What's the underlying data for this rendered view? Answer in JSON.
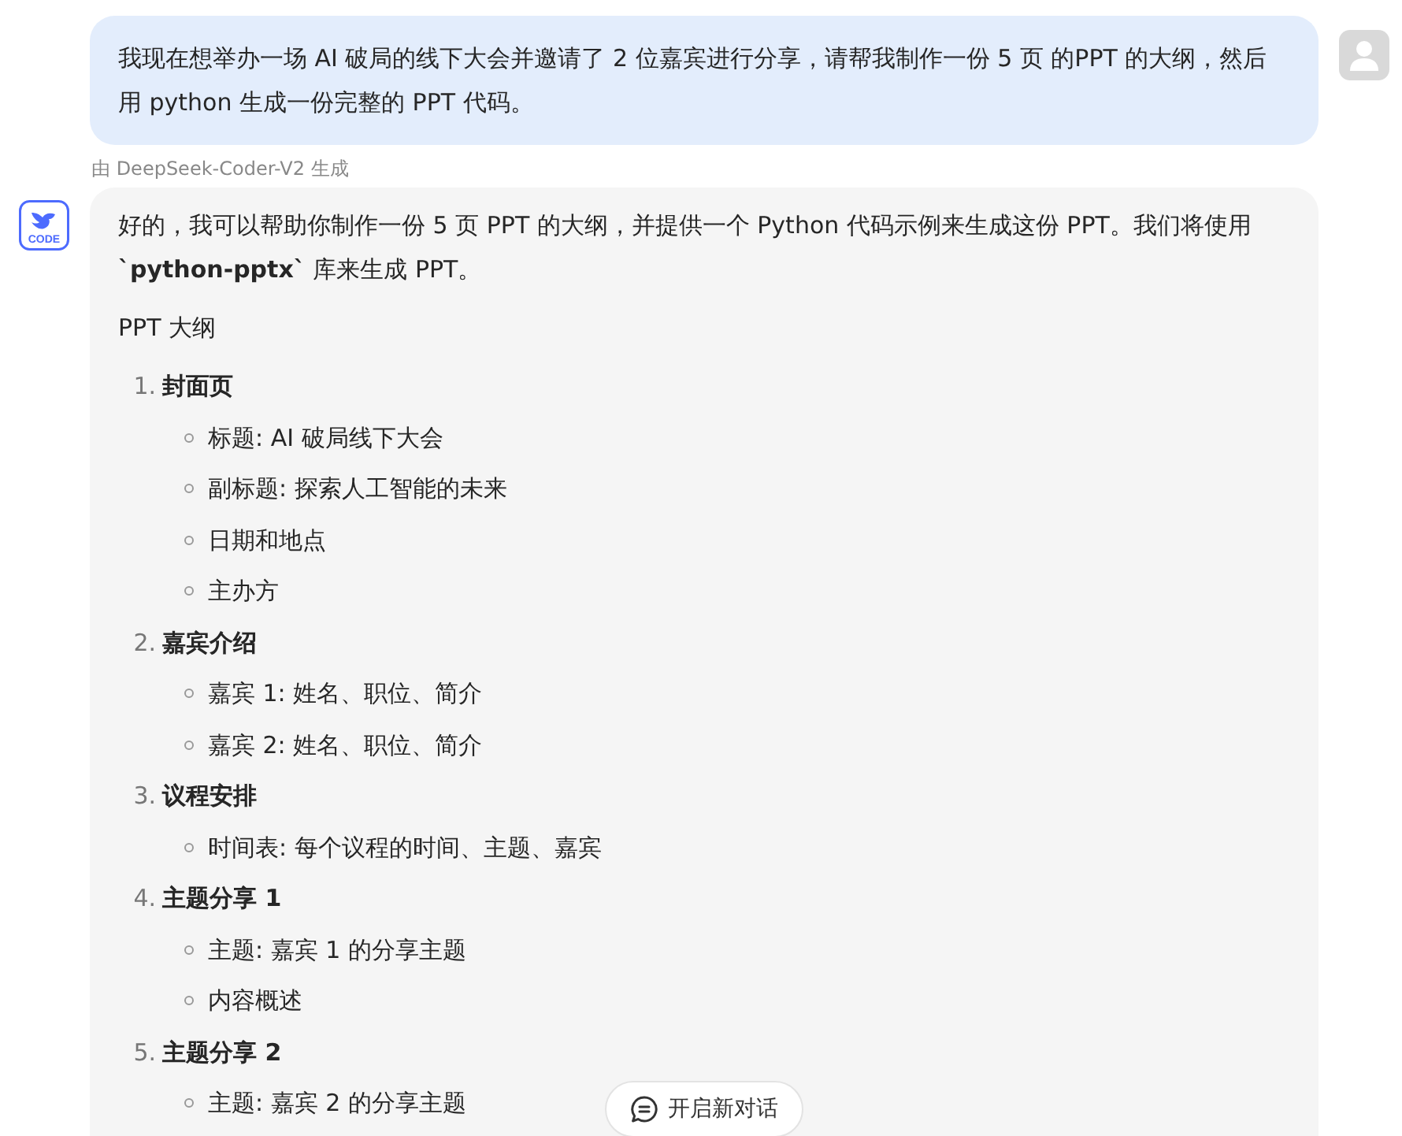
{
  "user_message": {
    "text": "我现在想举办一场 AI 破局的线下大会并邀请了 2 位嘉宾进行分享，请帮我制作一份 5 页 的PPT 的大纲，然后用 python 生成一份完整的 PPT 代码。"
  },
  "model_label": "由 DeepSeek-Coder-V2 生成",
  "bot_icon_label": "CODE",
  "reply": {
    "intro": "好的，我可以帮助你制作一份 5 页 PPT 的大纲，并提供一个 Python 代码示例来生成这份 PPT。我们将使用 **`python-pptx`** 库来生成 PPT。",
    "heading": "PPT 大纲",
    "outline": [
      {
        "number": "1.",
        "title": "封面页",
        "children": [
          {
            "text": "标题: AI 破局线下大会"
          },
          {
            "text": "副标题: 探索人工智能的未来"
          },
          {
            "text": "日期和地点"
          },
          {
            "text": "主办方"
          }
        ]
      },
      {
        "number": "2.",
        "title": "嘉宾介绍",
        "children": [
          {
            "text": "嘉宾 1: 姓名、职位、简介"
          },
          {
            "text": "嘉宾 2: 姓名、职位、简介"
          }
        ]
      },
      {
        "number": "3.",
        "title": "议程安排",
        "children": [
          {
            "text": "时间表: 每个议程的时间、主题、嘉宾"
          }
        ]
      },
      {
        "number": "4.",
        "title": "主题分享 1",
        "children": [
          {
            "text": "主题: 嘉宾 1 的分享主题"
          },
          {
            "text": "内容概述"
          }
        ]
      },
      {
        "number": "5.",
        "title": "主题分享 2",
        "children": [
          {
            "text": "主题: 嘉宾 2 的分享主题"
          }
        ]
      }
    ]
  },
  "new_chat_button": {
    "label": "开启新对话"
  }
}
